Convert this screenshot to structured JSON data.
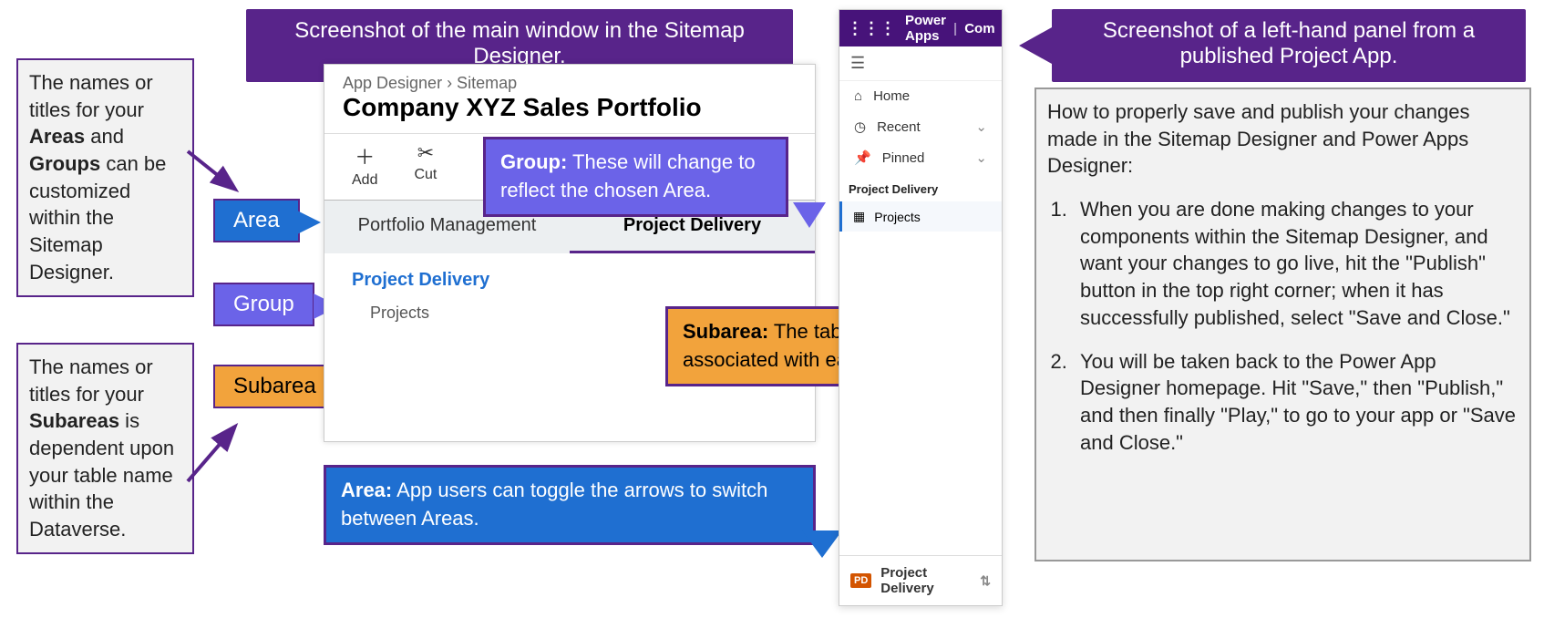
{
  "callouts": {
    "main_window": "Screenshot of the main window in the Sitemap Designer.",
    "left_panel": "Screenshot of a left-hand panel from a published Project App.",
    "group_label": "Group:",
    "group_text": " These will change to reflect the chosen Area.",
    "subarea_label": "Subarea:",
    "subarea_text": " The tables and forms associated with each subarea.",
    "area_label": "Area:",
    "area_text": " App users can toggle the arrows to switch between Areas."
  },
  "left_boxes": {
    "areas_groups_pre": "The names or titles for your ",
    "areas_groups_b1": "Areas",
    "areas_groups_mid": " and ",
    "areas_groups_b2": "Groups",
    "areas_groups_post": " can be customized within the Sitemap Designer.",
    "subareas_pre": "The names or titles for your ",
    "subareas_b1": "Subareas",
    "subareas_post": " is dependent upon your table name within the Dataverse."
  },
  "tags": {
    "area": "Area",
    "group": "Group",
    "subarea": "Subarea"
  },
  "sitemap": {
    "breadcrumb": "App Designer  ›  Sitemap",
    "title": "Company XYZ Sales Portfolio",
    "add": "Add",
    "cut": "Cut",
    "tab_portfolio": "Portfolio Management",
    "tab_delivery": "Project Delivery",
    "group": "Project Delivery",
    "subarea": "Projects"
  },
  "app_panel": {
    "brand": "Power Apps",
    "brand_right": "Com",
    "home": "Home",
    "recent": "Recent",
    "pinned": "Pinned",
    "section": "Project Delivery",
    "subarea": "Projects",
    "footer_badge": "PD",
    "footer_text": "Project Delivery"
  },
  "howto": {
    "intro": "How to properly save and publish your changes made in the Sitemap Designer and Power Apps Designer:",
    "step1": "When you are done making changes to your components within the Sitemap Designer, and want your changes to go live, hit the \"Publish\" button in the top right corner; when it has successfully published, select \"Save and Close.\"",
    "step2": "You will be taken back to the Power App Designer homepage. Hit \"Save,\" then \"Publish,\" and then finally \"Play,\" to go to your app or \"Save and Close.\""
  }
}
